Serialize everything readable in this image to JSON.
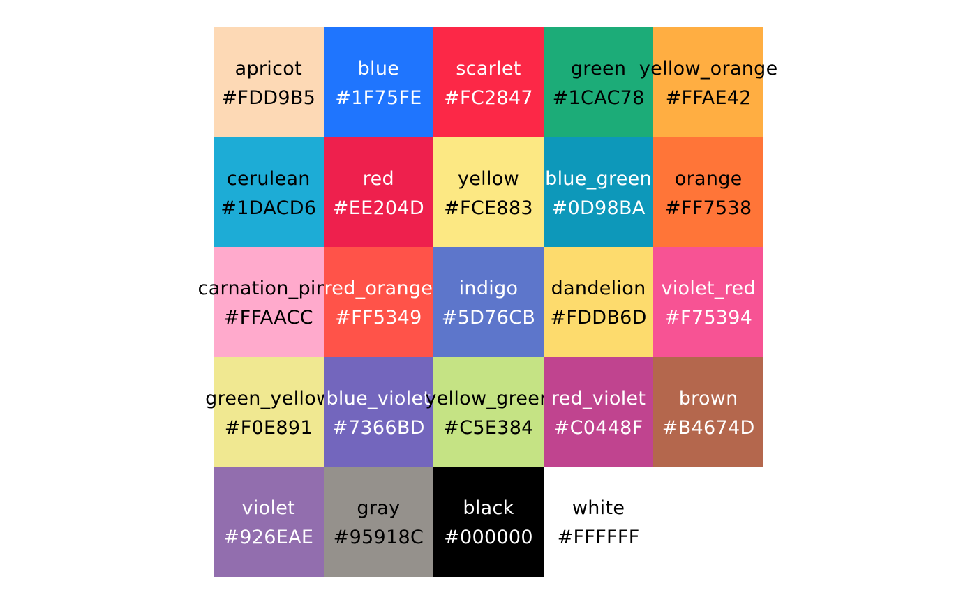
{
  "swatches": [
    {
      "name": "apricot",
      "hex": "#FDD9B5",
      "color": "#FDD9B5",
      "text_color": "#000000"
    },
    {
      "name": "blue",
      "hex": "#1F75FE",
      "color": "#1F75FE",
      "text_color": "#FFFFFF"
    },
    {
      "name": "scarlet",
      "hex": "#FC2847",
      "color": "#FC2847",
      "text_color": "#FFFFFF"
    },
    {
      "name": "green",
      "hex": "#1CAC78",
      "color": "#1CAC78",
      "text_color": "#000000"
    },
    {
      "name": "yellow_orange",
      "hex": "#FFAE42",
      "color": "#FFAE42",
      "text_color": "#000000"
    },
    {
      "name": "cerulean",
      "hex": "#1DACD6",
      "color": "#1DACD6",
      "text_color": "#000000"
    },
    {
      "name": "red",
      "hex": "#EE204D",
      "color": "#EE204D",
      "text_color": "#FFFFFF"
    },
    {
      "name": "yellow",
      "hex": "#FCE883",
      "color": "#FCE883",
      "text_color": "#000000"
    },
    {
      "name": "blue_green",
      "hex": "#0D98BA",
      "color": "#0D98BA",
      "text_color": "#FFFFFF"
    },
    {
      "name": "orange",
      "hex": "#FF7538",
      "color": "#FF7538",
      "text_color": "#000000"
    },
    {
      "name": "carnation_pink",
      "hex": "#FFAACC",
      "color": "#FFAACC",
      "text_color": "#000000"
    },
    {
      "name": "red_orange",
      "hex": "#FF5349",
      "color": "#FF5349",
      "text_color": "#FFFFFF"
    },
    {
      "name": "indigo",
      "hex": "#5D76CB",
      "color": "#5D76CB",
      "text_color": "#FFFFFF"
    },
    {
      "name": "dandelion",
      "hex": "#FDDB6D",
      "color": "#FDDB6D",
      "text_color": "#000000"
    },
    {
      "name": "violet_red",
      "hex": "#F75394",
      "color": "#F75394",
      "text_color": "#FFFFFF"
    },
    {
      "name": "green_yellow",
      "hex": "#F0E891",
      "color": "#F0E891",
      "text_color": "#000000"
    },
    {
      "name": "blue_violet",
      "hex": "#7366BD",
      "color": "#7366BD",
      "text_color": "#FFFFFF"
    },
    {
      "name": "yellow_green",
      "hex": "#C5E384",
      "color": "#C5E384",
      "text_color": "#000000"
    },
    {
      "name": "red_violet",
      "hex": "#C0448F",
      "color": "#C0448F",
      "text_color": "#FFFFFF"
    },
    {
      "name": "brown",
      "hex": "#B4674D",
      "color": "#B4674D",
      "text_color": "#FFFFFF"
    },
    {
      "name": "violet",
      "hex": "#926EAE",
      "color": "#926EAE",
      "text_color": "#FFFFFF"
    },
    {
      "name": "gray",
      "hex": "#95918C",
      "color": "#95918C",
      "text_color": "#000000"
    },
    {
      "name": "black",
      "hex": "#000000",
      "color": "#000000",
      "text_color": "#FFFFFF"
    },
    {
      "name": "white",
      "hex": "#FFFFFF",
      "color": "#FFFFFF",
      "text_color": "#000000"
    }
  ]
}
